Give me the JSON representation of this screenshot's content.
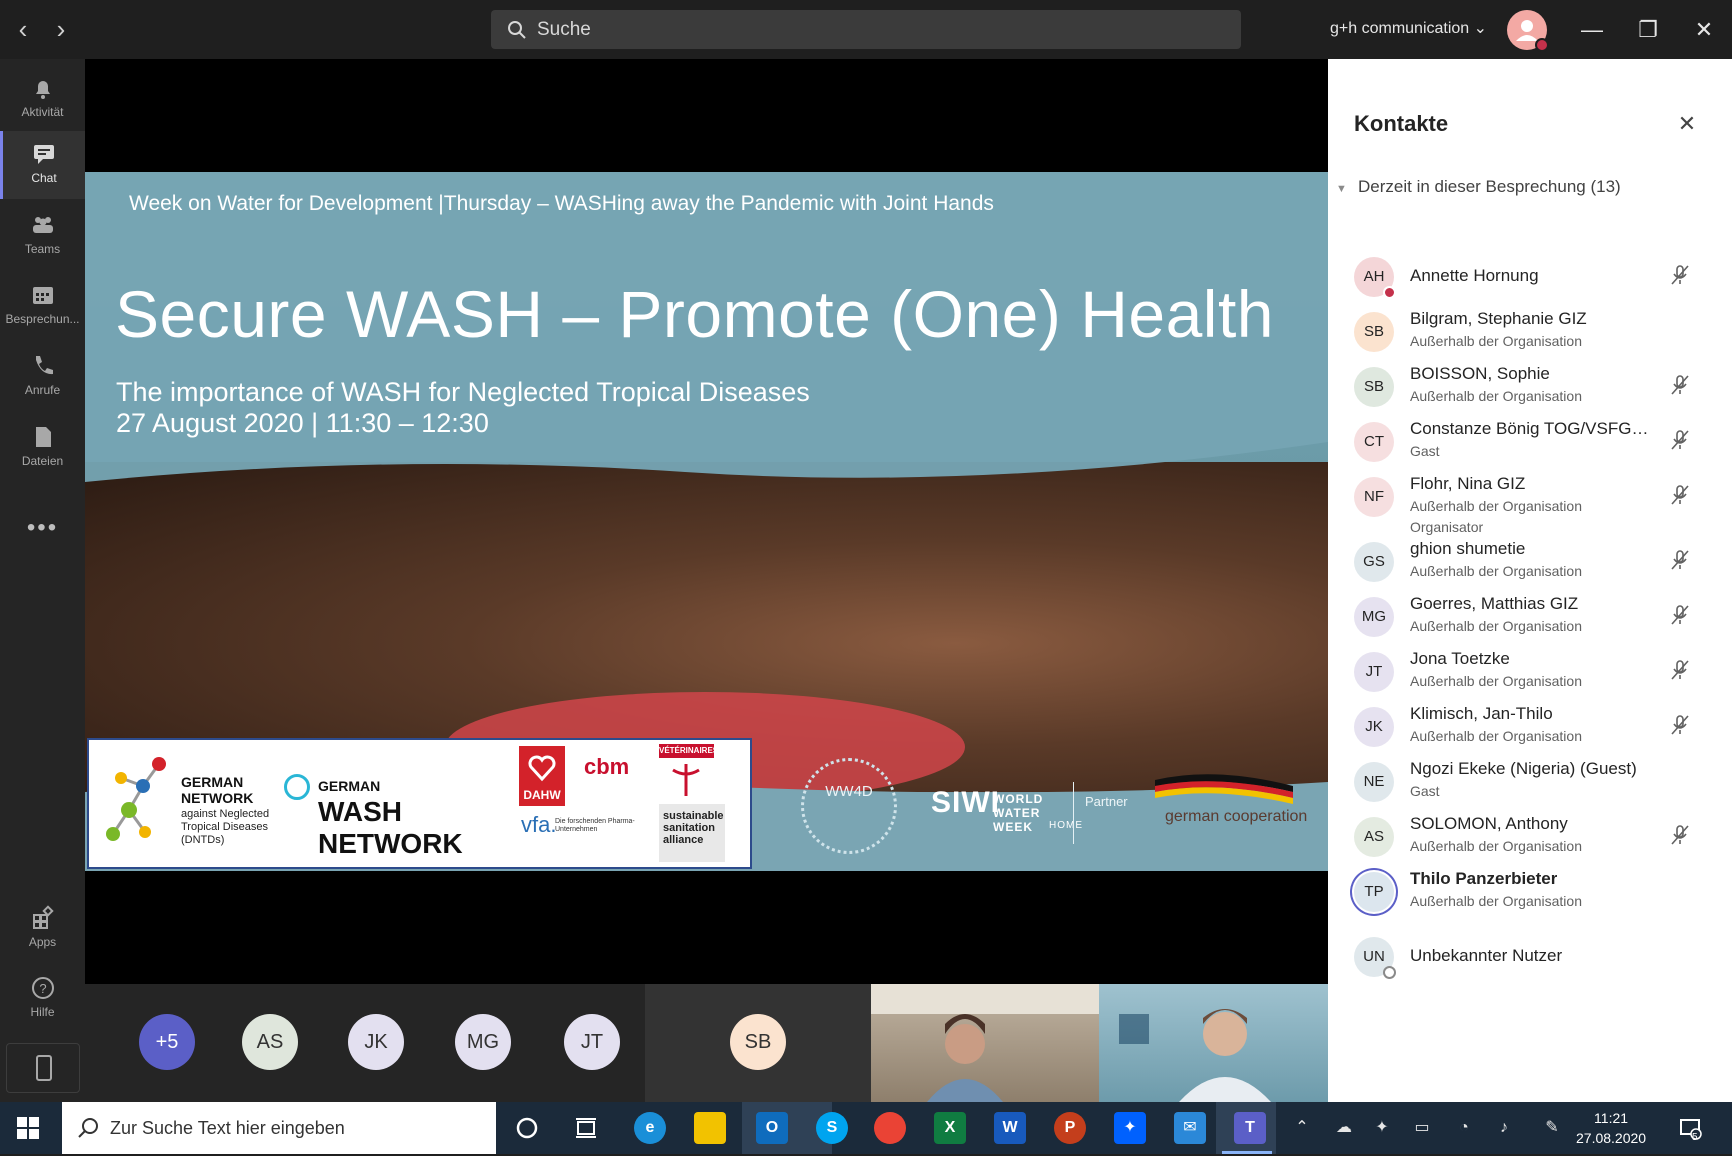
{
  "titlebar": {
    "search_placeholder": "Suche",
    "account_name": "g+h communication",
    "minimize": "—",
    "restore": "❐",
    "close": "✕"
  },
  "rail": {
    "items": [
      {
        "label": "Aktivität",
        "icon": "bell-icon"
      },
      {
        "label": "Chat",
        "icon": "chat-icon"
      },
      {
        "label": "Teams",
        "icon": "teams-icon"
      },
      {
        "label": "Besprechun...",
        "icon": "calendar-icon"
      },
      {
        "label": "Anrufe",
        "icon": "phone-icon"
      },
      {
        "label": "Dateien",
        "icon": "file-icon"
      }
    ],
    "more": "•••",
    "apps": "Apps",
    "help": "Hilfe"
  },
  "slide": {
    "header": "Week on Water for Development  |Thursday – WASHing away the Pandemic with Joint Hands",
    "title": "Secure WASH – Promote (One) Health",
    "subtitle": "The importance of WASH for Neglected Tropical Diseases",
    "date_line": "27 August 2020 | 11:30 – 12:30",
    "logos": {
      "gn_title": "GERMAN NETWORK",
      "gn_sub": "against Neglected Tropical Diseases (DNTDs)",
      "wash_german": "GERMAN",
      "wash_word": "WASH",
      "wash_network": "NETWORK",
      "dahw": "DAHW",
      "cbm": "cbm",
      "vet": "VÉTÉRINAIRES",
      "vfa": "vfa.",
      "vfa_sub": "Die forschenden Pharma-Unternehmen",
      "ssa": "sustainable sanitation alliance",
      "ww4d": "WW4D",
      "siwi": "SIWI",
      "siwi_ww": "WORLD WATER WEEK",
      "siwi_home": "HOME",
      "partner": "Partner",
      "gc": "german cooperation"
    }
  },
  "strip": {
    "overflow": "+5",
    "avatars": [
      "AS",
      "JK",
      "MG",
      "JT"
    ],
    "speaker": "SB"
  },
  "panel": {
    "title": "Kontakte",
    "section": "Derzeit in dieser Besprechung (13)",
    "contacts": [
      {
        "initials": "AH",
        "name": "Annette Hornung",
        "status": "",
        "role": "",
        "muted": true,
        "color": "#f4d6d8",
        "presence": "busy"
      },
      {
        "initials": "SB",
        "name": "Bilgram, Stephanie GIZ",
        "status": "Außerhalb der Organisation",
        "role": "",
        "muted": false,
        "color": "#fbe3cf",
        "presence": ""
      },
      {
        "initials": "SB",
        "name": "BOISSON, Sophie",
        "status": "Außerhalb der Organisation",
        "role": "",
        "muted": true,
        "color": "#dfe8df",
        "presence": ""
      },
      {
        "initials": "CT",
        "name": "Constanze Bönig TOG/VSFG ...",
        "status": "Gast",
        "role": "",
        "muted": true,
        "color": "#f6dfe0",
        "presence": ""
      },
      {
        "initials": "NF",
        "name": "Flohr, Nina GIZ",
        "status": "Außerhalb der Organisation",
        "role": "Organisator",
        "muted": true,
        "color": "#f6dfe0",
        "presence": ""
      },
      {
        "initials": "GS",
        "name": "ghion shumetie",
        "status": "Außerhalb der Organisation",
        "role": "",
        "muted": true,
        "color": "#e0e8ec",
        "presence": ""
      },
      {
        "initials": "MG",
        "name": "Goerres, Matthias GIZ",
        "status": "Außerhalb der Organisation",
        "role": "",
        "muted": true,
        "color": "#e6e2f0",
        "presence": ""
      },
      {
        "initials": "JT",
        "name": "Jona Toetzke",
        "status": "Außerhalb der Organisation",
        "role": "",
        "muted": true,
        "color": "#e6e2f0",
        "presence": ""
      },
      {
        "initials": "JK",
        "name": "Klimisch, Jan-Thilo",
        "status": "Außerhalb der Organisation",
        "role": "",
        "muted": true,
        "color": "#e6e2f0",
        "presence": ""
      },
      {
        "initials": "NE",
        "name": "Ngozi Ekeke (Nigeria) (Guest)",
        "status": "Gast",
        "role": "",
        "muted": false,
        "color": "#e0e8ec",
        "presence": ""
      },
      {
        "initials": "AS",
        "name": "SOLOMON, Anthony",
        "status": "Außerhalb der Organisation",
        "role": "",
        "muted": true,
        "color": "#e4ebe1",
        "presence": ""
      },
      {
        "initials": "TP",
        "name": "Thilo Panzerbieter",
        "status": "Außerhalb der Organisation",
        "role": "",
        "muted": false,
        "color": "#dce6ee",
        "presence": "",
        "speaking": true
      },
      {
        "initials": "UN",
        "name": "Unbekannter Nutzer",
        "status": "",
        "role": "",
        "muted": false,
        "color": "#e0e8ec",
        "presence": "offline"
      }
    ]
  },
  "taskbar": {
    "search_placeholder": "Zur Suche Text hier eingeben",
    "time": "11:21",
    "date": "27.08.2020",
    "notifications": "5"
  }
}
